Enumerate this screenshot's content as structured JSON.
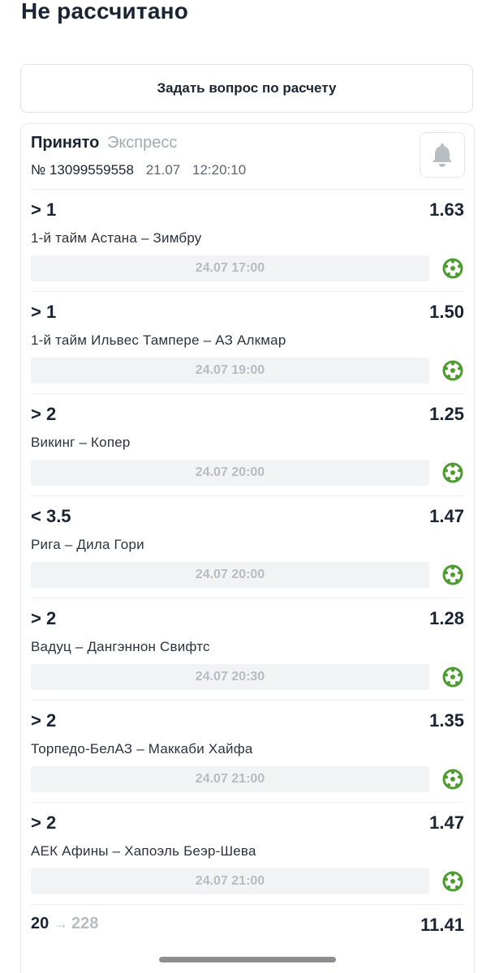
{
  "page_title": "Не рассчитано",
  "ask_button_label": "Задать вопрос по расчету",
  "bet": {
    "status": "Принято",
    "type": "Экспресс",
    "number": "№ 13099559558",
    "date": "21.07",
    "time": "12:20:10",
    "bell_icon": "bell-icon"
  },
  "events": [
    {
      "outcome": "> 1",
      "odds": "1.63",
      "match": "1-й тайм Астана – Зимбру",
      "datetime": "24.07 17:00",
      "sport_icon": "soccer-ball-icon"
    },
    {
      "outcome": "> 1",
      "odds": "1.50",
      "match": "1-й тайм Ильвес Тампере – АЗ Алкмар",
      "datetime": "24.07 19:00",
      "sport_icon": "soccer-ball-icon"
    },
    {
      "outcome": "> 2",
      "odds": "1.25",
      "match": "Викинг – Копер",
      "datetime": "24.07 20:00",
      "sport_icon": "soccer-ball-icon"
    },
    {
      "outcome": "< 3.5",
      "odds": "1.47",
      "match": "Рига – Дила Гори",
      "datetime": "24.07 20:00",
      "sport_icon": "soccer-ball-icon"
    },
    {
      "outcome": "> 2",
      "odds": "1.28",
      "match": "Вадуц – Дангэннон Свифтс",
      "datetime": "24.07 20:30",
      "sport_icon": "soccer-ball-icon"
    },
    {
      "outcome": "> 2",
      "odds": "1.35",
      "match": "Торпедо-БелАЗ – Маккаби Хайфа",
      "datetime": "24.07 21:00",
      "sport_icon": "soccer-ball-icon"
    },
    {
      "outcome": "> 2",
      "odds": "1.47",
      "match": "АЕК Афины – Хапоэль Беэр-Шева",
      "datetime": "24.07 21:00",
      "sport_icon": "soccer-ball-icon"
    }
  ],
  "total": {
    "stake": "20",
    "arrow": "→",
    "potential_win": "228",
    "odds": "11.41"
  },
  "colors": {
    "text_primary": "#1b2433",
    "text_muted": "#a3a9b1",
    "sport_icon_green": "#4b9b2e",
    "date_bar_bg": "#f2f3f5"
  }
}
